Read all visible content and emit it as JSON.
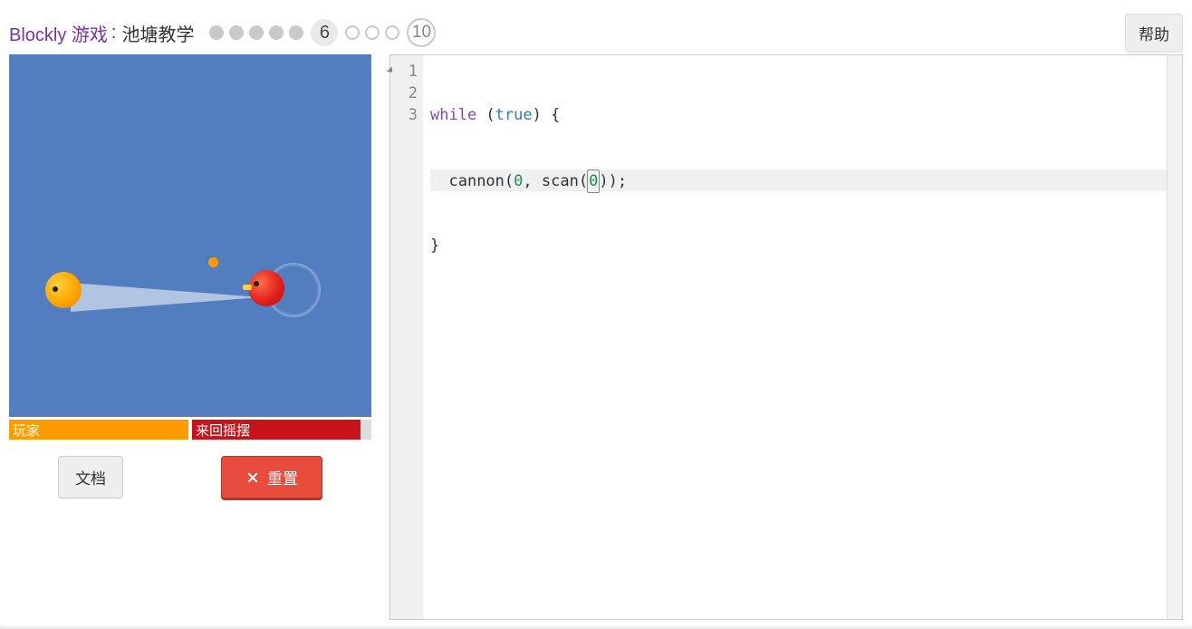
{
  "header": {
    "title_link": "Blockly 游戏",
    "separator": " : ",
    "subtitle": "池塘教学",
    "help_label": "帮助"
  },
  "levels": {
    "current": 6,
    "current_label": "6",
    "total_label": "10"
  },
  "pond": {
    "player_label": "玩家",
    "enemy_label": "来回摇摆"
  },
  "buttons": {
    "docs_label": "文档",
    "reset_label": "重置"
  },
  "editor": {
    "gutter": [
      "1",
      "2",
      "3"
    ],
    "active_line_index": 1,
    "code": {
      "line1": {
        "kw": "while",
        "p_open": " (",
        "bool": "true",
        "p_close": ") {"
      },
      "line2": {
        "indent": "  ",
        "fn1": "cannon",
        "open1": "(",
        "n1": "0",
        "comma": ", ",
        "fn2": "scan",
        "open2": "(",
        "n2": "0",
        "close": "));"
      },
      "line3": {
        "brace": "}"
      }
    }
  }
}
